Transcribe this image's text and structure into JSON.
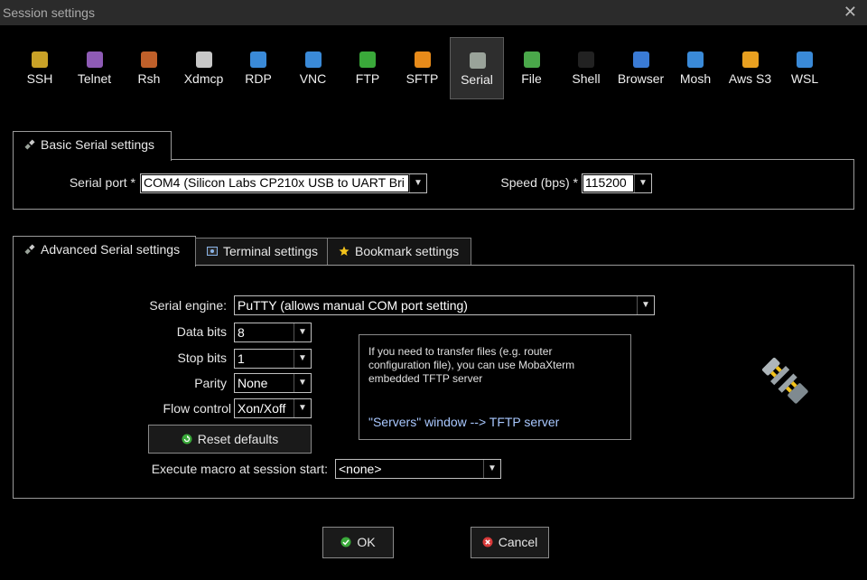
{
  "window": {
    "title": "Session settings",
    "close_glyph": "✕"
  },
  "session_types": [
    {
      "label": "SSH",
      "icon": "wrench-icon",
      "color": "#c9a227"
    },
    {
      "label": "Telnet",
      "icon": "sphere-icon",
      "color": "#8e5bb5"
    },
    {
      "label": "Rsh",
      "icon": "link-icon",
      "color": "#c0602a"
    },
    {
      "label": "Xdmcp",
      "icon": "x-window-icon",
      "color": "#c8c8c8"
    },
    {
      "label": "RDP",
      "icon": "monitor-icon",
      "color": "#3a8ad8"
    },
    {
      "label": "VNC",
      "icon": "vnc-icon",
      "color": "#3a8ad8"
    },
    {
      "label": "FTP",
      "icon": "globe-icon",
      "color": "#3aa93a"
    },
    {
      "label": "SFTP",
      "icon": "globe-orange-icon",
      "color": "#e88b1a"
    },
    {
      "label": "Serial",
      "icon": "serial-plug-icon",
      "color": "#9aa39a"
    },
    {
      "label": "File",
      "icon": "file-monitor-icon",
      "color": "#4aa84a"
    },
    {
      "label": "Shell",
      "icon": "terminal-icon",
      "color": "#222222"
    },
    {
      "label": "Browser",
      "icon": "browser-globe-icon",
      "color": "#3a7bd5"
    },
    {
      "label": "Mosh",
      "icon": "satellite-icon",
      "color": "#3a8ad8"
    },
    {
      "label": "Aws S3",
      "icon": "cubes-icon",
      "color": "#e8a020"
    },
    {
      "label": "WSL",
      "icon": "windows-icon",
      "color": "#3a8ad8"
    }
  ],
  "selected_type": "Serial",
  "basic": {
    "tab_label": "Basic Serial settings",
    "serial_port_label": "Serial port *",
    "serial_port_value": "COM4  (Silicon Labs CP210x USB to UART Bri",
    "speed_label": "Speed (bps) *",
    "speed_value": "115200"
  },
  "advanced_tabs": [
    {
      "label": "Advanced Serial settings",
      "icon": "serial-plug-icon"
    },
    {
      "label": "Terminal settings",
      "icon": "terminal-settings-icon"
    },
    {
      "label": "Bookmark settings",
      "icon": "star-icon"
    }
  ],
  "advanced": {
    "engine_label": "Serial engine:",
    "engine_value": "PuTTY    (allows manual COM port setting)",
    "data_bits_label": "Data bits",
    "data_bits_value": "8",
    "stop_bits_label": "Stop bits",
    "stop_bits_value": "1",
    "parity_label": "Parity",
    "parity_value": "None",
    "flow_label": "Flow control",
    "flow_value": "Xon/Xoff",
    "reset_label": "Reset defaults",
    "macro_label": "Execute macro at session start:",
    "macro_value": "<none>",
    "info_text": "If you need to transfer files (e.g. router configuration file), you can use MobaXterm embedded TFTP server",
    "info_link": "\"Servers\" window  -->  TFTP server",
    "info_link_color": "#a9c8ff"
  },
  "buttons": {
    "ok": "OK",
    "cancel": "Cancel"
  }
}
